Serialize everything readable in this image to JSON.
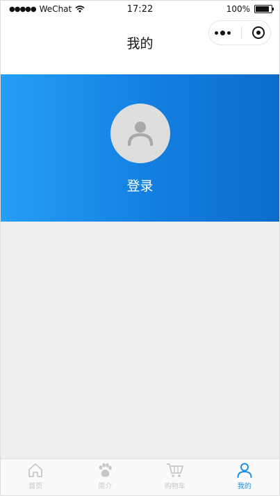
{
  "status_bar": {
    "signal": "●●●●●",
    "carrier": "WeChat",
    "time": "17:22",
    "battery": "100%"
  },
  "nav": {
    "title": "我的"
  },
  "profile": {
    "login_label": "登录"
  },
  "tabbar": {
    "items": [
      {
        "label": "首页",
        "icon": "home-icon",
        "active": false
      },
      {
        "label": "简介",
        "icon": "paw-icon",
        "active": false
      },
      {
        "label": "购物车",
        "icon": "cart-icon",
        "active": false
      },
      {
        "label": "我的",
        "icon": "user-icon",
        "active": true
      }
    ]
  },
  "colors": {
    "accent": "#1a8fe8",
    "hero_start": "#259ff6",
    "hero_end": "#0a6dcc",
    "inactive": "#c7c7c7",
    "background": "#efefef"
  }
}
